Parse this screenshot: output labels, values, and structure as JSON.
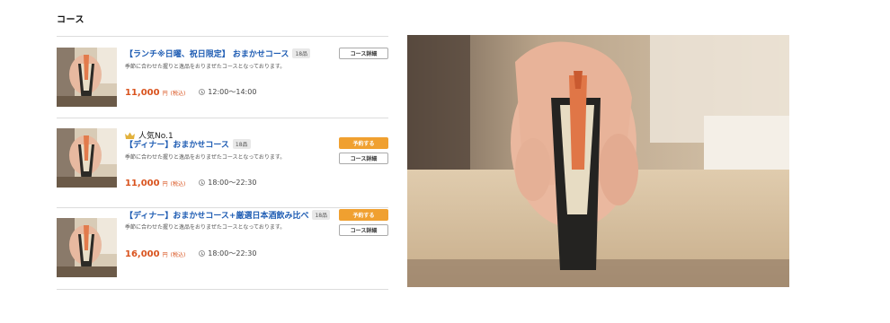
{
  "section": {
    "title": "コース"
  },
  "courses": [
    {
      "badge": "",
      "title": "【ランチ※日曜、祝日限定】 おまかせコース",
      "count": "18品",
      "description": "季節に合わせた握りと逸品をおりまぜたコースとなっております。",
      "price": "11,000",
      "price_unit": "円",
      "tax": "(税込)",
      "time": "12:00〜14:00",
      "reserve_label": "",
      "detail_label": "コース詳細"
    },
    {
      "badge": "人気No.1",
      "title": "【ディナー】おまかせコース",
      "count": "18品",
      "description": "季節に合わせた握りと逸品をおりまぜたコースとなっております。",
      "price": "11,000",
      "price_unit": "円",
      "tax": "(税込)",
      "time": "18:00〜22:30",
      "reserve_label": "予約する",
      "detail_label": "コース詳細"
    },
    {
      "badge": "",
      "title": "【ディナー】おまかせコース+厳選日本酒飲み比べ",
      "count": "18品",
      "description": "季節に合わせた握りと逸品をおりまぜたコースとなっております。",
      "price": "16,000",
      "price_unit": "円",
      "tax": "(税込)",
      "time": "18:00〜22:30",
      "reserve_label": "予約する",
      "detail_label": "コース詳細"
    }
  ],
  "icons": {
    "clock": "clock-icon",
    "crown": "crown-icon"
  },
  "colors": {
    "title_blue": "#1e5cb3",
    "price_orange": "#d9531e",
    "reserve_button": "#f0a030",
    "crown_gold": "#e2b13c"
  }
}
